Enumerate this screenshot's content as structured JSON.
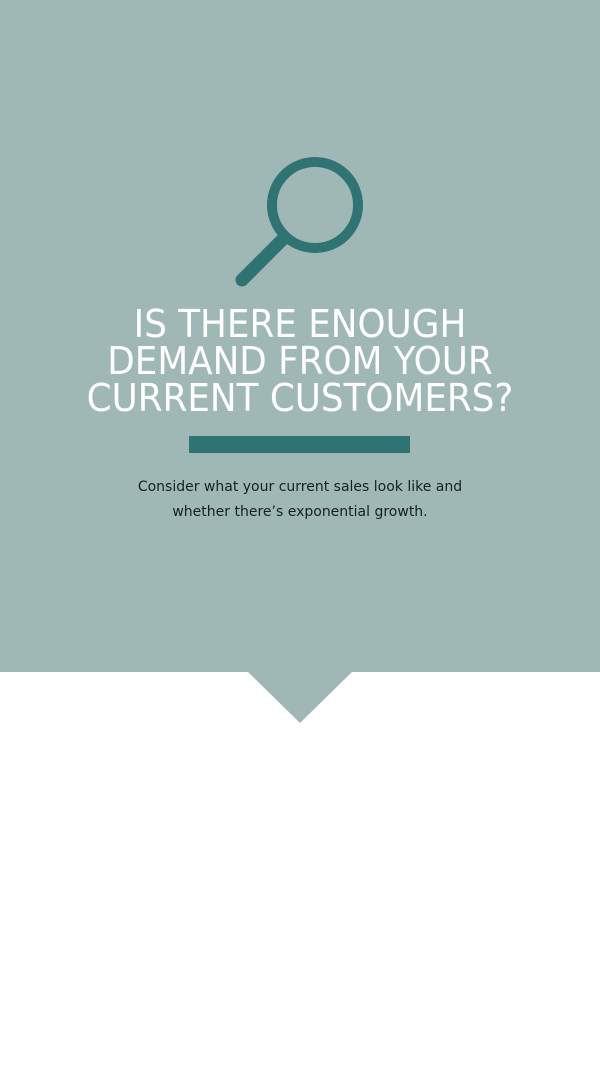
{
  "colors": {
    "panel_background": "#9fb8b6",
    "accent": "#2f7472",
    "title_text": "#ffffff",
    "body_text": "#14201f",
    "page_background": "#ffffff"
  },
  "icon": {
    "name": "magnifying-glass-icon"
  },
  "heading": {
    "lines": [
      "IS THERE ENOUGH",
      "DEMAND FROM YOUR",
      "CURRENT CUSTOMERS?"
    ]
  },
  "description": {
    "lines": [
      "Consider what your current sales look like and",
      "whether there’s exponential growth."
    ]
  }
}
